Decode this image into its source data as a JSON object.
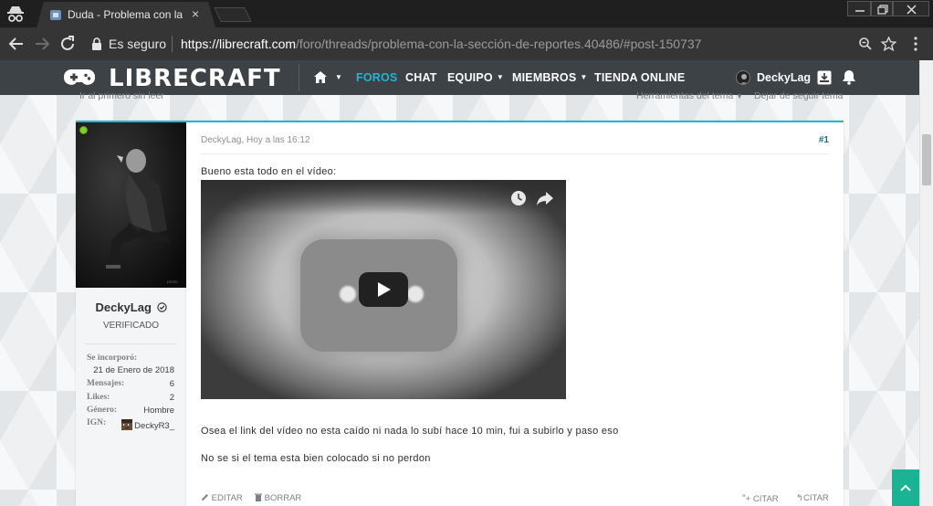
{
  "browser": {
    "tab": {
      "title": "Duda - Problema con la sección de reportes",
      "close": "×"
    },
    "window": {
      "minimize": "minimize",
      "restore": "restore",
      "close": "close"
    },
    "address": {
      "security_label": "Es seguro",
      "url_domain": "https://librecraft.com",
      "url_path": "/foro/threads/problema-con-la-sección-de-reportes.40486/#post-150737"
    },
    "icons": [
      "incognito-icon",
      "back-icon",
      "forward-icon",
      "reload-icon",
      "lock-icon",
      "zoom-icon",
      "star-icon",
      "menu-icon"
    ]
  },
  "site": {
    "logo": "LIBRECRAFT",
    "nav": {
      "foros": "FOROS",
      "chat": "CHAT",
      "equipo": "EQUIPO",
      "miembros": "MIEMBROS",
      "tienda": "TIENDA ONLINE"
    },
    "user": {
      "name": "DeckyLag"
    },
    "accent": "#1fb6d7",
    "nav_bg": "#3c4246"
  },
  "thread": {
    "first_unread": "Ir al primero sin leer",
    "tools": "Herramientas del tema",
    "unwatch": "Dejar de seguir tema"
  },
  "post": {
    "author": {
      "name": "DeckyLag",
      "title": "VERIFICADO",
      "stats": [
        {
          "label": "Se incorporó:",
          "value": "21 de Enero de 2018"
        },
        {
          "label": "Mensajes:",
          "value": "6"
        },
        {
          "label": "Likes:",
          "value": "2"
        },
        {
          "label": "Género:",
          "value": "Hombre"
        },
        {
          "label": "IGN:",
          "value": "DeckyR3_"
        }
      ]
    },
    "meta": "DeckyLag, Hoy a las 16:12",
    "number": "#1",
    "body": [
      "Bueno esta todo en el vídeo:",
      "Osea el link del vídeo no esta caído ni nada lo subí hace 10 min, fui a subirlo y paso eso",
      "No se si el tema esta bien colocado si no perdon"
    ],
    "actions": {
      "edit": "EDITAR",
      "delete": "BORRAR",
      "multi_quote": "+ CITAR",
      "quote": "CITAR"
    }
  }
}
